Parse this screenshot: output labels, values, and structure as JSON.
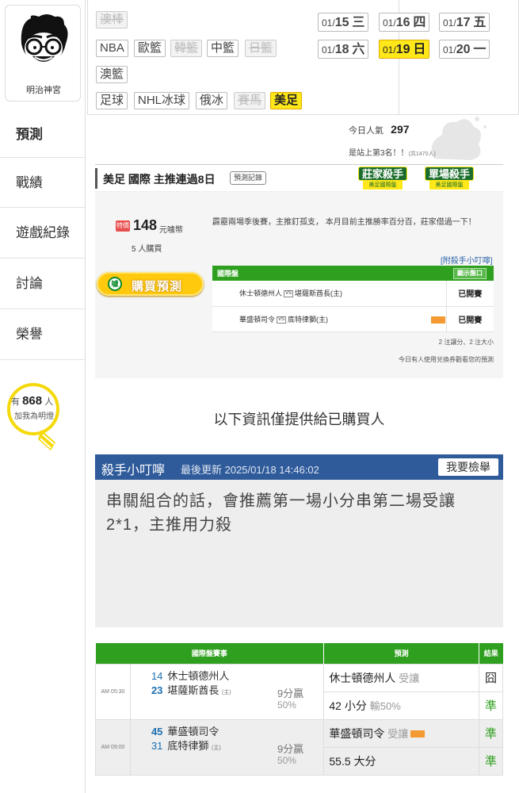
{
  "sidebar": {
    "avatar_name": "明治神宮",
    "items": [
      {
        "label": "預測"
      },
      {
        "label": "戰績"
      },
      {
        "label": "遊戲紀錄"
      },
      {
        "label": "討論"
      },
      {
        "label": "榮譽"
      }
    ],
    "bulb": {
      "prefix": "有",
      "count": "868",
      "suffix": "人",
      "cta": "加我為明燈"
    }
  },
  "sports": {
    "row0": [
      {
        "label": "澳棒",
        "state": "dim"
      }
    ],
    "row1": [
      {
        "label": "NBA",
        "state": "normal"
      },
      {
        "label": "歐籃",
        "state": "normal"
      },
      {
        "label": "韓籃",
        "state": "dim"
      },
      {
        "label": "中籃",
        "state": "normal"
      },
      {
        "label": "日籃",
        "state": "dim"
      }
    ],
    "row2": [
      {
        "label": "澳籃",
        "state": "normal"
      }
    ],
    "row3": [
      {
        "label": "足球",
        "state": "normal"
      },
      {
        "label": "NHL冰球",
        "state": "normal"
      },
      {
        "label": "俄冰",
        "state": "normal"
      },
      {
        "label": "賽馬",
        "state": "dim"
      },
      {
        "label": "美足",
        "state": "active"
      }
    ]
  },
  "dates": [
    {
      "month": "01/",
      "day": "15",
      "dow": "三",
      "selected": false
    },
    {
      "month": "01/",
      "day": "16",
      "dow": "四",
      "selected": false
    },
    {
      "month": "01/",
      "day": "17",
      "dow": "五",
      "selected": false
    },
    {
      "month": "01/",
      "day": "18",
      "dow": "六",
      "selected": false
    },
    {
      "month": "01/",
      "day": "19",
      "dow": "日",
      "selected": true
    },
    {
      "month": "01/",
      "day": "20",
      "dow": "一",
      "selected": false
    }
  ],
  "stats": {
    "popularity_label": "今日人氣",
    "popularity": "297",
    "rank_text": "是站上第3名！！",
    "rank_total": "(共1470人)"
  },
  "prediction": {
    "title": "美足 國際 主推連過8日",
    "record_button": "預測記錄",
    "badge1": {
      "top": "莊家殺手",
      "bottom": "美足國際盤"
    },
    "badge2": {
      "top": "單場殺手",
      "bottom": "美足國際盤"
    },
    "price_icon": "特價",
    "price": "148",
    "price_unit": "元噱幣",
    "buyers": "5 人購買",
    "description": "霹靂兩場季後賽，主推釘孤支， 本月目前主推勝率百分百，莊家借過一下！",
    "buy_button": "購買預測",
    "buy_icon": "噱",
    "tip_link": "[附殺手小叮嚀]",
    "table_header": "國際盤",
    "show_button": "顯示盤口",
    "games": [
      {
        "away": "休士頓德州人",
        "home": "堪薩斯酋長(主)",
        "status": "已開賽"
      },
      {
        "away": "華盛頓司令",
        "home": "底特律獅(主)",
        "status": "已開賽"
      }
    ],
    "note": "2 注讓分、2 注大小",
    "note2": "今日有人使用兌換券觀看您的預測"
  },
  "info_text": "以下資訊僅提供給已購買人",
  "tip": {
    "title": "殺手小叮嚀",
    "updated": "最後更新 2025/01/18 14:46:02",
    "report_button": "我要檢舉",
    "body": "串關組合的話，會推薦第一場小分串第二場受讓2*1，主推用力殺"
  },
  "games_table": {
    "headers": [
      "國際盤賽事",
      "預測",
      "結果"
    ],
    "rows": [
      {
        "time": "AM 05:30",
        "away_no": "14",
        "away": "休士頓德州人",
        "home_no": "23",
        "home": "堪薩斯酋長",
        "host": "(主)",
        "win": "9分贏",
        "win_pct": "50%",
        "pred1": "休士頓德州人",
        "pred1_sub": "受讓",
        "res1": "囧",
        "pred2": "42 小分",
        "pred2_sub": "輸50%",
        "res2": "準"
      },
      {
        "time": "AM 09:00",
        "away_no": "45",
        "away": "華盛頓司令",
        "home_no": "31",
        "home": "底特律獅",
        "host": "(主)",
        "win": "9分贏",
        "win_pct": "50%",
        "pred1": "華盛頓司令",
        "pred1_sub": "受讓",
        "res1": "準",
        "pred2": "55.5 大分",
        "pred2_sub": "",
        "res2": "準"
      }
    ]
  },
  "colors": {
    "accent_green": "#2e9f1e",
    "tip_blue": "#2f5b9b",
    "highlight_yellow": "#ffe81a",
    "link_blue": "#2b63a8"
  }
}
